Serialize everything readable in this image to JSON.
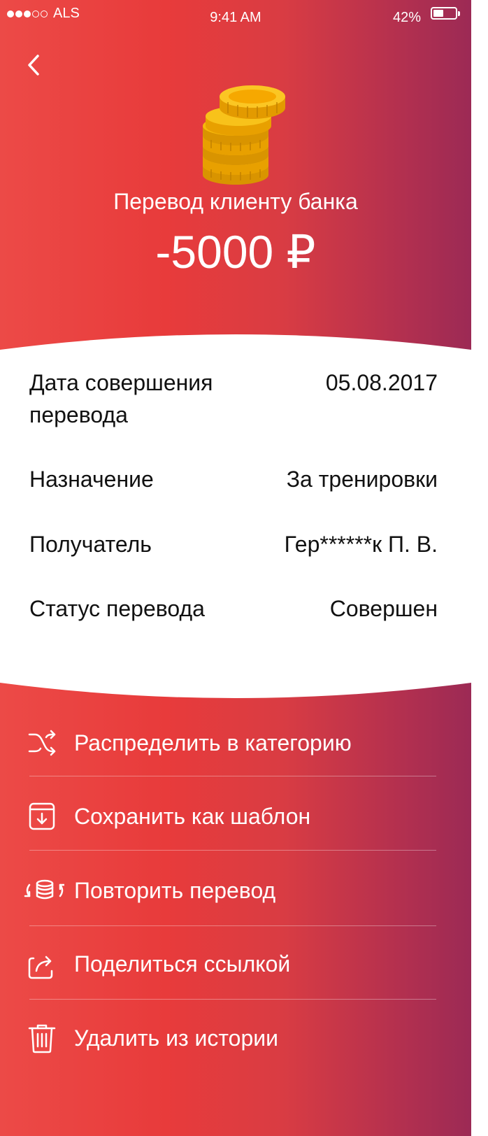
{
  "status_bar": {
    "carrier": "ALS",
    "time": "9:41 AM",
    "battery": "42%",
    "signal_bars": 3,
    "signal_total": 5,
    "battery_level": 0.42
  },
  "header": {
    "back_icon": "chevron-left-icon",
    "coins_icon": "coins-stack-icon",
    "title": "Перевод клиенту банка",
    "amount": "-5000 ₽"
  },
  "details": [
    {
      "label": "Дата совершения перевода",
      "value": "05.08.2017"
    },
    {
      "label": "Назначение",
      "value": "За тренировки"
    },
    {
      "label": "Получатель",
      "value": "Гер******к П. В."
    },
    {
      "label": "Статус перевода",
      "value": "Совершен"
    }
  ],
  "actions": [
    {
      "label": "Распределить в категорию",
      "icon": "shuffle-icon"
    },
    {
      "label": "Сохранить как шаблон",
      "icon": "save-template-icon"
    },
    {
      "label": "Повторить перевод",
      "icon": "repeat-coins-icon"
    },
    {
      "label": "Поделиться ссылкой",
      "icon": "share-icon"
    },
    {
      "label": "Удалить из истории",
      "icon": "trash-icon"
    }
  ],
  "colors": {
    "gradient_start": "#ec4a47",
    "gradient_end": "#9c2a55",
    "coin": "#f5b800",
    "card": "#ffffff"
  }
}
